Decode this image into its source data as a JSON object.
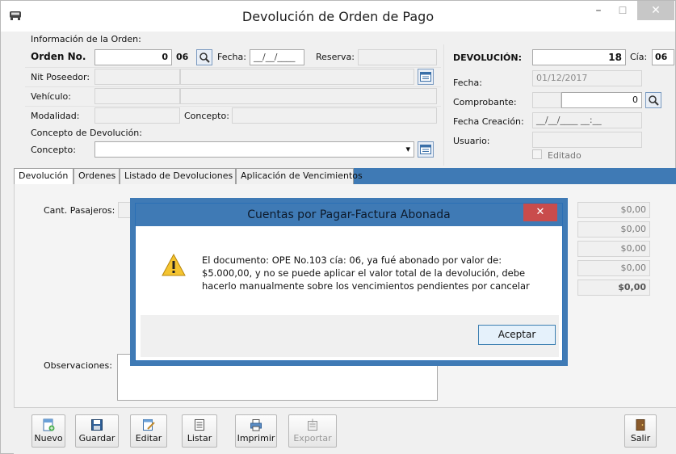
{
  "window": {
    "title": "Devolución de Orden de Pago"
  },
  "info": {
    "section_label": "Información de la Orden:",
    "orden_label": "Orden No.",
    "orden_value": "0",
    "orden_cia": "06",
    "fecha_label": "Fecha:",
    "fecha_value": "__/__/____",
    "reserva_label": "Reserva:",
    "nit_label": "Nit Poseedor:",
    "vehiculo_label": "Vehículo:",
    "modalidad_label": "Modalidad:",
    "concepto_label": "Concepto:",
    "concepto_dev_label": "Concepto de Devolución:",
    "concepto2_label": "Concepto:",
    "concepto2_arrow": "▾"
  },
  "devolucion": {
    "label": "DEVOLUCIÓN:",
    "number": "18",
    "cia_label": "Cía:",
    "cia_value": "06",
    "fecha_label": "Fecha:",
    "fecha_value": "01/12/2017",
    "comprobante_label": "Comprobante:",
    "comprobante_value": "0",
    "fecha_creacion_label": "Fecha Creación:",
    "fecha_creacion_value": "__/__/____ __:__",
    "usuario_label": "Usuario:",
    "editado_label": "Editado"
  },
  "tabs": [
    "Devolución",
    "Ordenes",
    "Listado de Devoluciones",
    "Aplicación de Vencimientos"
  ],
  "tab_devolucion": {
    "cant_pasajeros_label": "Cant. Pasajeros:",
    "observaciones_label": "Observaciones:",
    "amounts": [
      "$0,00",
      "$0,00",
      "$0,00",
      "$0,00"
    ],
    "total": "$0,00"
  },
  "toolbar": {
    "nuevo": "Nuevo",
    "guardar": "Guardar",
    "editar": "Editar",
    "listar": "Listar",
    "imprimir": "Imprimir",
    "exportar": "Exportar",
    "salir": "Salir"
  },
  "dialog": {
    "title": "Cuentas por Pagar-Factura Abonada",
    "message_line1": "El documento: OPE  No.103 cía: 06, ya fué abonado por valor de:",
    "message_line2": "$5.000,00, y no se puede aplicar el valor total de la devolución, debe",
    "message_line3": "hacerlo manualmente sobre los vencimientos pendientes por cancelar",
    "ok_label": "Aceptar",
    "close_glyph": "✕"
  },
  "titlebar_buttons": {
    "minimize": "–",
    "maximize": "☐",
    "close": "✕"
  }
}
